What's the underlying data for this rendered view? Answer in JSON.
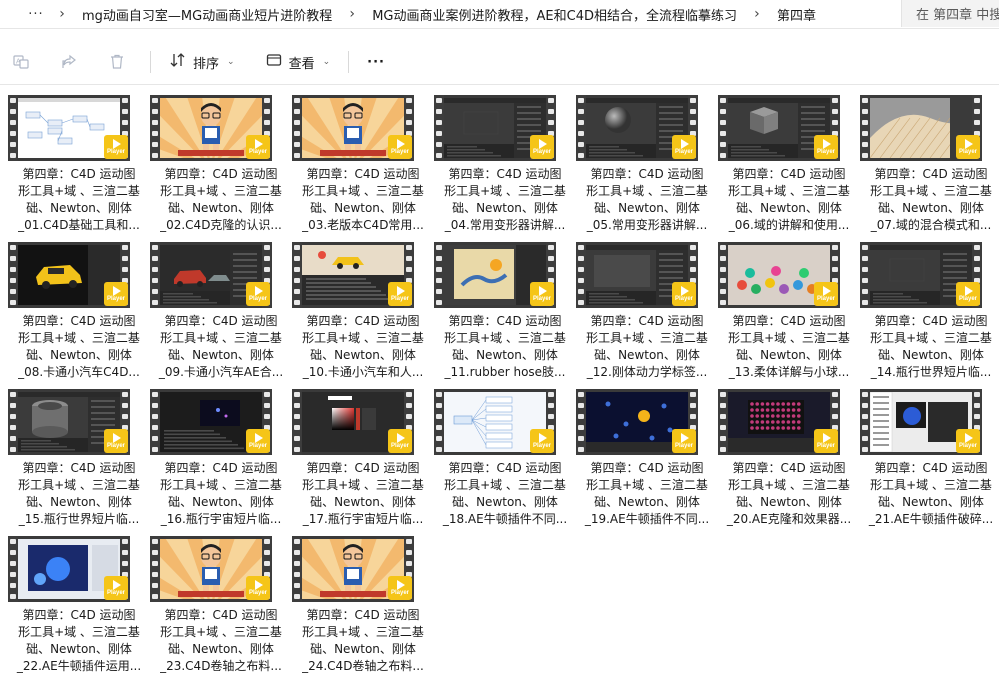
{
  "breadcrumb": {
    "more": "···",
    "items": [
      "mg动画自习室—MG动画商业短片进阶教程",
      "MG动画商业案例进阶教程，AE和C4D相结合，全流程临摹练习",
      "第四章"
    ],
    "search_placeholder": "在 第四章 中搜索"
  },
  "toolbar": {
    "sort_label": "排序",
    "view_label": "查看",
    "more_label": "···",
    "icons": [
      "translate-icon",
      "share-icon",
      "delete-icon",
      "sort-icon",
      "view-icon",
      "more-icon"
    ]
  },
  "colors": {
    "badge": "#f5c518",
    "film": "#3d3d3d",
    "accent": "#0067c0"
  },
  "badge_label": "Player",
  "files": [
    {
      "line1": "第四章：C4D 运动图",
      "line2": "形工具+域 、三渲二基",
      "line3": "础、Newton、刚体",
      "line4": "_01.C4D基础工具和...",
      "thumb": "diagram"
    },
    {
      "line1": "第四章：C4D 运动图",
      "line2": "形工具+域 、三渲二基",
      "line3": "础、Newton、刚体",
      "line4": "_02.C4D克隆的认识...",
      "thumb": "cartoon"
    },
    {
      "line1": "第四章：C4D 运动图",
      "line2": "形工具+域 、三渲二基",
      "line3": "础、Newton、刚体",
      "line4": "_03.老版本C4D常用...",
      "thumb": "cartoon"
    },
    {
      "line1": "第四章：C4D 运动图",
      "line2": "形工具+域 、三渲二基",
      "line3": "础、Newton、刚体",
      "line4": "_04.常用变形器讲解...",
      "thumb": "dark-ui"
    },
    {
      "line1": "第四章：C4D 运动图",
      "line2": "形工具+域 、三渲二基",
      "line3": "础、Newton、刚体",
      "line4": "_05.常用变形器讲解...",
      "thumb": "sphere"
    },
    {
      "line1": "第四章：C4D 运动图",
      "line2": "形工具+域 、三渲二基",
      "line3": "础、Newton、刚体",
      "line4": "_06.域的讲解和使用...",
      "thumb": "cube"
    },
    {
      "line1": "第四章：C4D 运动图",
      "line2": "形工具+域 、三渲二基",
      "line3": "础、Newton、刚体",
      "line4": "_07.域的混合模式和...",
      "thumb": "field"
    },
    {
      "line1": "第四章：C4D 运动图",
      "line2": "形工具+域 、三渲二基",
      "line3": "础、Newton、刚体",
      "line4": "_08.卡通小汽车C4D...",
      "thumb": "car"
    },
    {
      "line1": "第四章：C4D 运动图",
      "line2": "形工具+域 、三渲二基",
      "line3": "础、Newton、刚体",
      "line4": "_09.卡通小汽车AE合...",
      "thumb": "car2"
    },
    {
      "line1": "第四章：C4D 运动图",
      "line2": "形工具+域 、三渲二基",
      "line3": "础、Newton、刚体",
      "line4": "_10.卡通小汽车和人...",
      "thumb": "car3"
    },
    {
      "line1": "第四章：C4D 运动图",
      "line2": "形工具+域 、三渲二基",
      "line3": "础、Newton、刚体",
      "line4": "_11.rubber hose肢...",
      "thumb": "rubber"
    },
    {
      "line1": "第四章：C4D 运动图",
      "line2": "形工具+域 、三渲二基",
      "line3": "础、Newton、刚体",
      "line4": "_12.刚体动力学标签...",
      "thumb": "grey"
    },
    {
      "line1": "第四章：C4D 运动图",
      "line2": "形工具+域 、三渲二基",
      "line3": "础、Newton、刚体",
      "line4": "_13.柔体详解与小球...",
      "thumb": "balls"
    },
    {
      "line1": "第四章：C4D 运动图",
      "line2": "形工具+域 、三渲二基",
      "line3": "础、Newton、刚体",
      "line4": "_14.瓶行世界短片临...",
      "thumb": "dark-ui"
    },
    {
      "line1": "第四章：C4D 运动图",
      "line2": "形工具+域 、三渲二基",
      "line3": "础、Newton、刚体",
      "line4": "_15.瓶行世界短片临...",
      "thumb": "cylinder"
    },
    {
      "line1": "第四章：C4D 运动图",
      "line2": "形工具+域 、三渲二基",
      "line3": "础、Newton、刚体",
      "line4": "_16.瓶行宇宙短片临...",
      "thumb": "space-ui"
    },
    {
      "line1": "第四章：C4D 运动图",
      "line2": "形工具+域 、三渲二基",
      "line3": "础、Newton、刚体",
      "line4": "_17.瓶行宇宙短片临...",
      "thumb": "color-picker"
    },
    {
      "line1": "第四章：C4D 运动图",
      "line2": "形工具+域 、三渲二基",
      "line3": "础、Newton、刚体",
      "line4": "_18.AE牛顿插件不同...",
      "thumb": "mindmap"
    },
    {
      "line1": "第四章：C4D 运动图",
      "line2": "形工具+域 、三渲二基",
      "line3": "础、Newton、刚体",
      "line4": "_19.AE牛顿插件不同...",
      "thumb": "planets"
    },
    {
      "line1": "第四章：C4D 运动图",
      "line2": "形工具+域 、三渲二基",
      "line3": "础、Newton、刚体",
      "line4": "_20.AE克隆和效果器...",
      "thumb": "dots-grid"
    },
    {
      "line1": "第四章：C4D 运动图",
      "line2": "形工具+域 、三渲二基",
      "line3": "础、Newton、刚体",
      "line4": "_21.AE牛顿插件破碎...",
      "thumb": "menu-ui"
    },
    {
      "line1": "第四章：C4D 运动图",
      "line2": "形工具+域 、三渲二基",
      "line3": "础、Newton、刚体",
      "line4": "_22.AE牛顿插件运用...",
      "thumb": "blue-balls"
    },
    {
      "line1": "第四章：C4D 运动图",
      "line2": "形工具+域 、三渲二基",
      "line3": "础、Newton、刚体",
      "line4": "_23.C4D卷轴之布料...",
      "thumb": "cartoon"
    },
    {
      "line1": "第四章：C4D 运动图",
      "line2": "形工具+域 、三渲二基",
      "line3": "础、Newton、刚体",
      "line4": "_24.C4D卷轴之布料...",
      "thumb": "cartoon"
    }
  ]
}
